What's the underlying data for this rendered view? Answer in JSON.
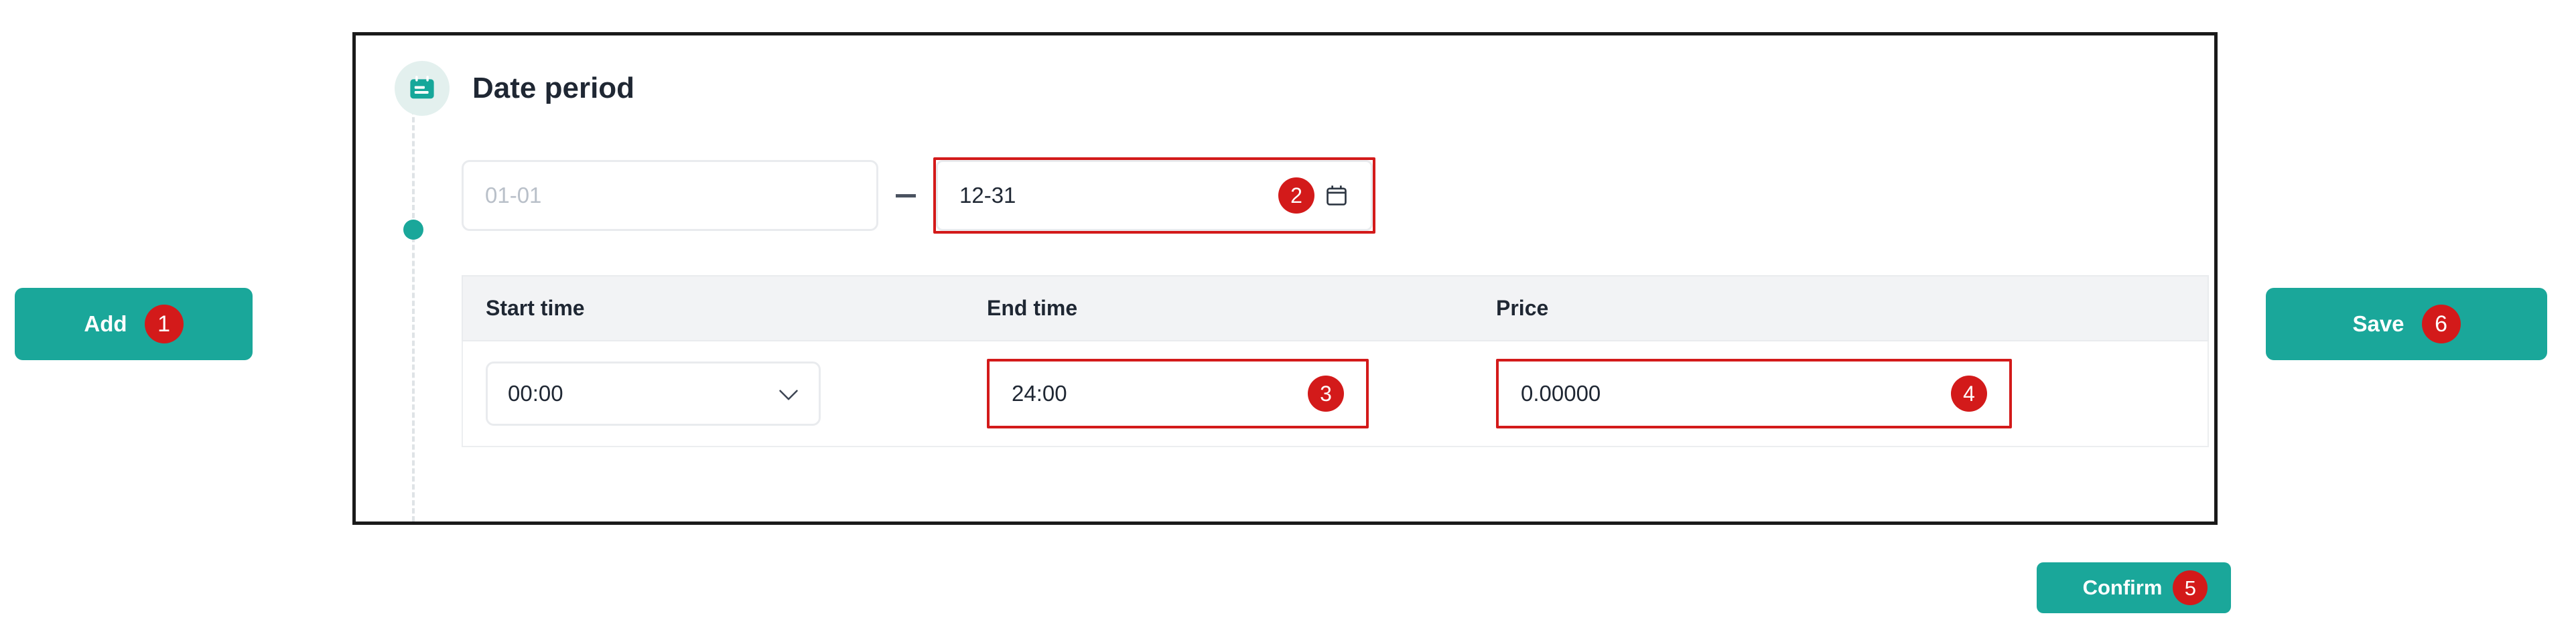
{
  "card": {
    "title": "Date period",
    "header_icon": "calendar-icon",
    "timeline_dot": "timeline-dot"
  },
  "date_period": {
    "start_date": {
      "value": "",
      "placeholder": "01-01"
    },
    "separator": "–",
    "end_date": {
      "value": "12-31",
      "placeholder": "12-31",
      "picker_icon": "calendar-picker-icon",
      "badge": "2"
    }
  },
  "table": {
    "columns": [
      "Start time",
      "End time",
      "Price"
    ],
    "rows": [
      {
        "start_time": {
          "value": "00:00",
          "options": [
            "00:00"
          ],
          "chevron_icon": "chevron-down-icon"
        },
        "end_time": {
          "value": "24:00",
          "placeholder": "24:00",
          "badge": "3"
        },
        "price": {
          "value": "0.00000",
          "placeholder": "0.00000",
          "badge": "4"
        }
      }
    ]
  },
  "actions": {
    "add": {
      "label": "Add",
      "badge": "1"
    },
    "save": {
      "label": "Save",
      "badge": "6"
    },
    "confirm": {
      "label": "Confirm",
      "badge": "5"
    }
  },
  "colors": {
    "accent_teal": "#1aa79a",
    "accent_teal_soft": "#e3f0ee",
    "badge_red": "#d31a1a",
    "card_border": "#1a1a1a",
    "field_border": "#e9ebee",
    "table_header_bg": "#f2f3f5",
    "text_primary": "#1f2733",
    "text_placeholder": "#b9c0c9"
  }
}
